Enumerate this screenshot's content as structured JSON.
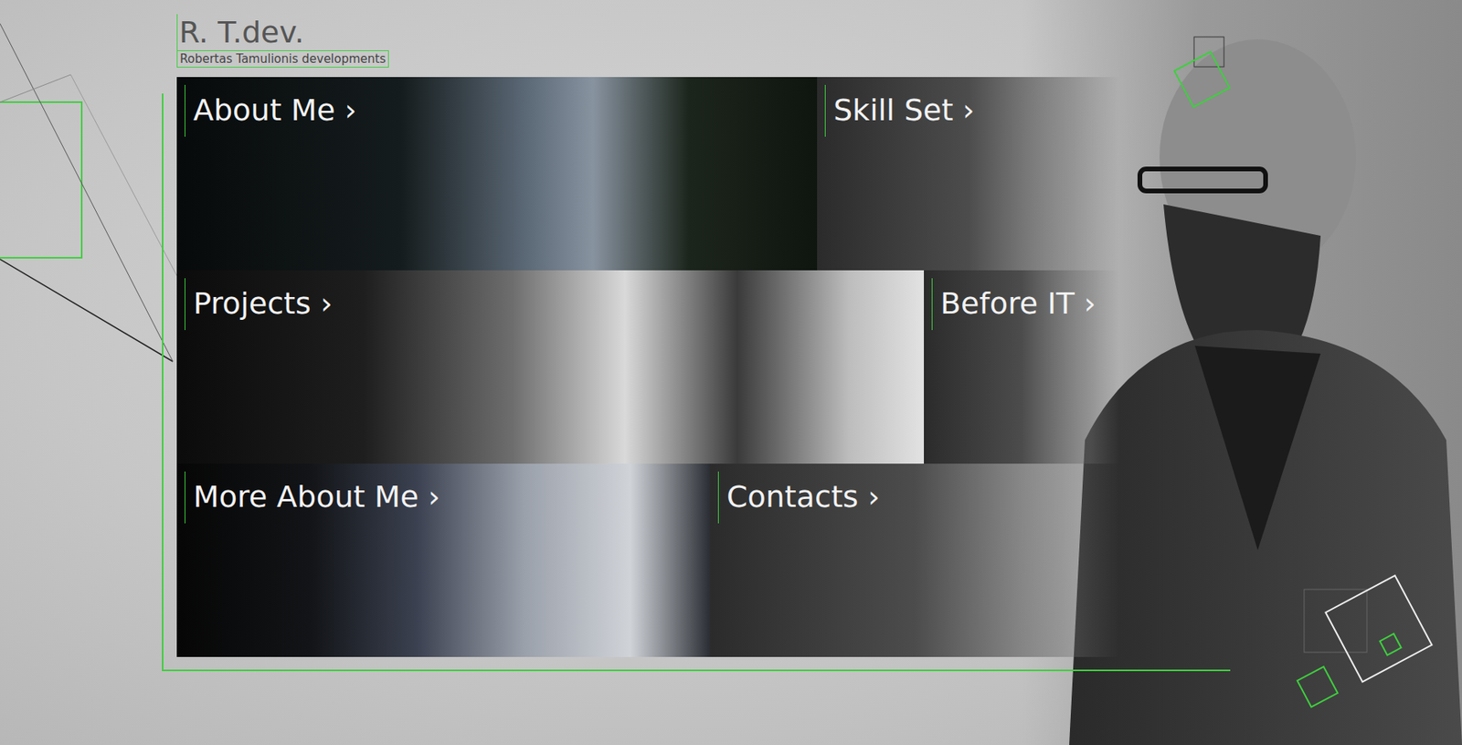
{
  "logo": {
    "title": "R. T.dev.",
    "subtitle": "Robertas Tamulionis developments"
  },
  "rows": [
    [
      {
        "label": "About Me ›",
        "kind": "photo"
      },
      {
        "label": "Skill Set ›",
        "kind": "plain"
      }
    ],
    [
      {
        "label": "Projects ›",
        "kind": "photo"
      },
      {
        "label": "Before IT ›",
        "kind": "plain"
      }
    ],
    [
      {
        "label": "More About Me ›",
        "kind": "photo"
      },
      {
        "label": "Contacts ›",
        "kind": "plain"
      }
    ]
  ]
}
